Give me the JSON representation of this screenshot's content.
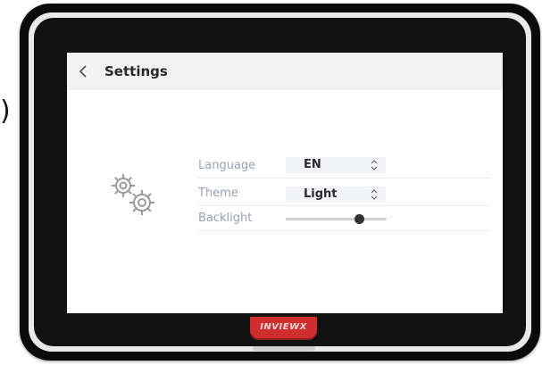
{
  "screen": {
    "title": "Settings",
    "back_icon": "chevron-left-icon",
    "illustration_icon": "gears-icon",
    "settings": {
      "language": {
        "label": "Language",
        "value": "EN"
      },
      "theme": {
        "label": "Theme",
        "value": "Light"
      },
      "backlight": {
        "label": "Backlight",
        "level_fraction": 0.73
      }
    }
  },
  "device": {
    "brand": "INVIEWX"
  },
  "colors": {
    "bezel": "#0b0b0b",
    "header_bg": "#f2f2f2",
    "label": "#9aa0b4",
    "brand_badge": "#cf2e2e"
  }
}
